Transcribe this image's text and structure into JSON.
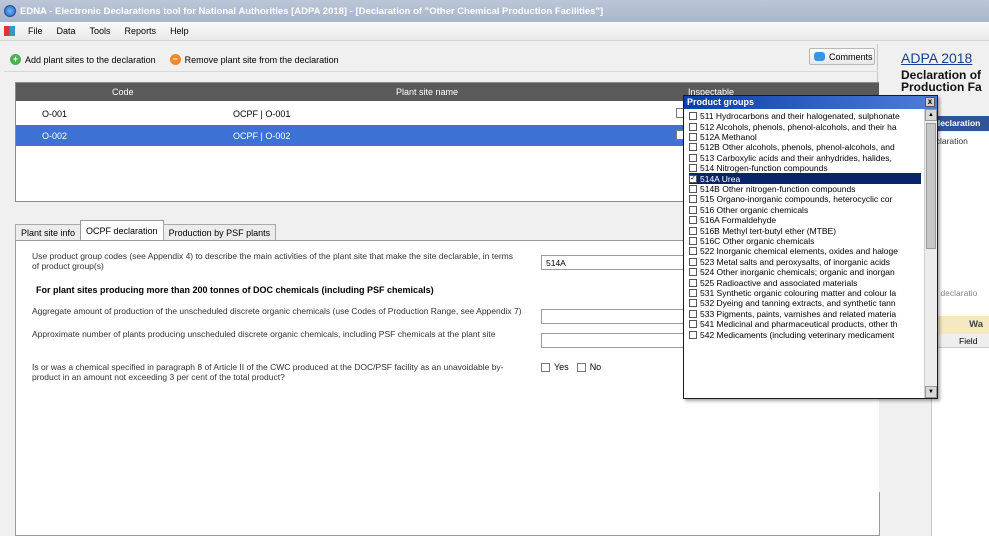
{
  "window": {
    "title": "EDNA - Electronic Declarations tool for National Authorities [ADPA 2018] - [Declaration of \"Other Chemical Production Facilities\"]"
  },
  "menu": [
    "File",
    "Data",
    "Tools",
    "Reports",
    "Help"
  ],
  "toolbar": {
    "add_label": "Add plant sites to the declaration",
    "remove_label": "Remove plant site from the declaration",
    "comments_label": "Comments"
  },
  "grid": {
    "headers": {
      "code": "Code",
      "name": "Plant site name",
      "inspectable": "Inspectable"
    },
    "rows": [
      {
        "code": "O-001",
        "name": "OCPF | O-001",
        "selected": false
      },
      {
        "code": "O-002",
        "name": "OCPF | O-002",
        "selected": true
      }
    ]
  },
  "tabs": [
    "Plant site info",
    "OCPF declaration",
    "Production by PSF plants"
  ],
  "form": {
    "q1": "Use product group codes (see Appendix 4) to describe the main activities of the plant site that make the site declarable, in terms of product group(s)",
    "q1_value": "514A",
    "section": "For plant sites producing more than 200 tonnes of DOC chemicals (including PSF chemicals)",
    "q2": "Aggregate amount of production of the unscheduled discrete organic chemicals (use Codes of Production Range, see Appendix 7)",
    "q3": "Approximate number of plants producing unscheduled discrete organic chemicals, including PSF chemicals at the plant site",
    "q4": "Is or was a chemical specified in paragraph 8 of Article II of the CWC produced at the DOC/PSF facility as an unavoidable by-product in an amount not exceeding 3 per cent of the total product?",
    "yes": "Yes",
    "no": "No"
  },
  "right": {
    "adpa": "ADPA 2018",
    "title_line1": "Declaration of",
    "title_line2": "Production Fa",
    "tab": "declaration",
    "sub": "eclaration",
    "to_decl": "to declaratio",
    "wa": "Wa",
    "field": "Field"
  },
  "popup": {
    "title": "Product groups",
    "close": "x",
    "options": [
      {
        "label": "511 Hydrocarbons and their halogenated, sulphonate",
        "checked": false,
        "selected": false
      },
      {
        "label": "512 Alcohols, phenols, phenol-alcohols, and their ha",
        "checked": false,
        "selected": false
      },
      {
        "label": "512A Methanol",
        "checked": false,
        "selected": false
      },
      {
        "label": "512B Other alcohols, phenols, phenol-alcohols, and",
        "checked": false,
        "selected": false
      },
      {
        "label": "513 Carboxylic acids and their anhydrides, halides,",
        "checked": false,
        "selected": false
      },
      {
        "label": "514 Nitrogen-function compounds",
        "checked": false,
        "selected": false
      },
      {
        "label": "514A Urea",
        "checked": true,
        "selected": true
      },
      {
        "label": "514B Other nitrogen-function compounds",
        "checked": false,
        "selected": false
      },
      {
        "label": "515 Organo-inorganic compounds, heterocyclic cor",
        "checked": false,
        "selected": false
      },
      {
        "label": "516 Other organic chemicals",
        "checked": false,
        "selected": false
      },
      {
        "label": "516A Formaldehyde",
        "checked": false,
        "selected": false
      },
      {
        "label": "516B Methyl tert-butyl ether (MTBE)",
        "checked": false,
        "selected": false
      },
      {
        "label": "516C Other organic chemicals",
        "checked": false,
        "selected": false
      },
      {
        "label": "522 Inorganic chemical elements, oxides and haloge",
        "checked": false,
        "selected": false
      },
      {
        "label": "523 Metal salts and peroxysalts, of inorganic acids",
        "checked": false,
        "selected": false
      },
      {
        "label": "524 Other inorganic chemicals; organic and inorgan",
        "checked": false,
        "selected": false
      },
      {
        "label": "525 Radioactive and associated materials",
        "checked": false,
        "selected": false
      },
      {
        "label": "531 Synthetic organic colouring matter and colour la",
        "checked": false,
        "selected": false
      },
      {
        "label": "532 Dyeing and tanning extracts, and synthetic tann",
        "checked": false,
        "selected": false
      },
      {
        "label": "533 Pigments, paints, varnishes and related materia",
        "checked": false,
        "selected": false
      },
      {
        "label": "541 Medicinal and pharmaceutical products, other th",
        "checked": false,
        "selected": false
      },
      {
        "label": "542 Medicaments (including veterinary medicament",
        "checked": false,
        "selected": false
      }
    ]
  },
  "colors": {
    "selection": "#3d71d3",
    "popup_title": "#0b3fa8",
    "link": "#1a3f88"
  }
}
